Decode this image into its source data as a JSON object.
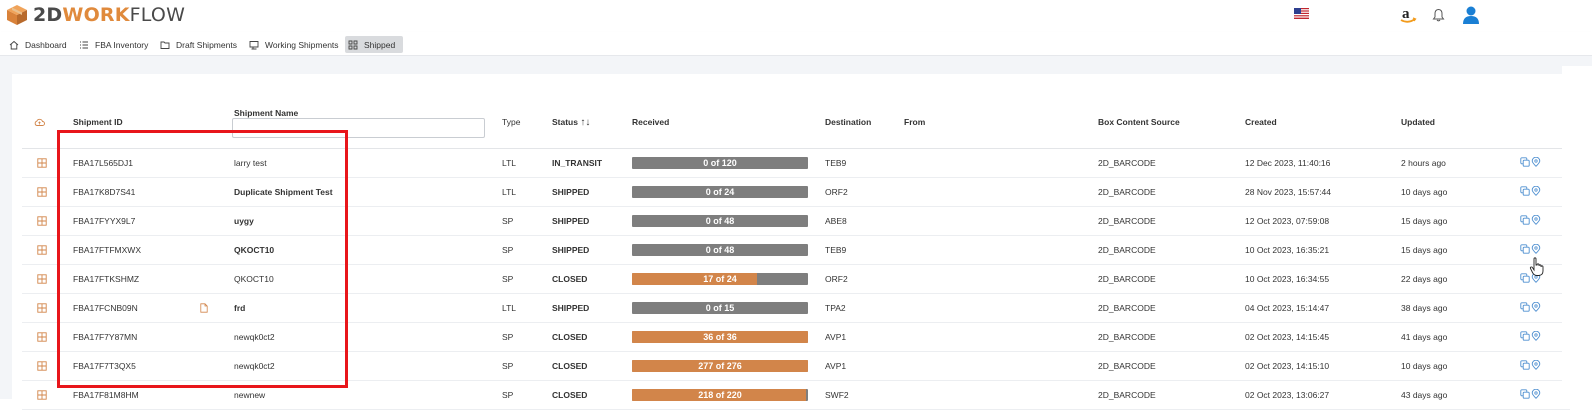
{
  "app": {
    "brand_a": "2D",
    "brand_b": "WORK",
    "brand_c": "FLOW"
  },
  "topbar_icons": [
    "us-flag-icon",
    "amazon-icon",
    "bell-icon",
    "user-icon"
  ],
  "nav": [
    {
      "label": "Dashboard",
      "icon": "home-icon"
    },
    {
      "label": "FBA Inventory",
      "icon": "list-icon"
    },
    {
      "label": "Draft Shipments",
      "icon": "folder-icon"
    },
    {
      "label": "Working Shipments",
      "icon": "monitor-icon"
    },
    {
      "label": "Shipped",
      "icon": "grid-icon",
      "active": true
    }
  ],
  "table": {
    "headers": {
      "shipment_id": "Shipment ID",
      "shipment_name": "Shipment Name",
      "type": "Type",
      "status": "Status",
      "status_sort": "↑↓",
      "received": "Received",
      "destination": "Destination",
      "from": "From",
      "box_content_source": "Box Content Source",
      "created": "Created",
      "updated": "Updated"
    },
    "search_placeholder": "",
    "rows": [
      {
        "id": "FBA17L565DJ1",
        "name": "larry test",
        "name_bold": false,
        "doc": false,
        "type": "LTL",
        "status": "IN_TRANSIT",
        "received_label": "0 of 120",
        "received_fraction": 0,
        "destination": "TEB9",
        "from": "",
        "source": "2D_BARCODE",
        "created": "12 Dec 2023, 11:40:16",
        "updated": "2 hours ago"
      },
      {
        "id": "FBA17K8D7S41",
        "name": "Duplicate Shipment Test",
        "name_bold": true,
        "doc": false,
        "type": "LTL",
        "status": "SHIPPED",
        "received_label": "0 of 24",
        "received_fraction": 0,
        "destination": "ORF2",
        "from": "",
        "source": "2D_BARCODE",
        "created": "28 Nov 2023, 15:57:44",
        "updated": "10 days ago"
      },
      {
        "id": "FBA17FYYX9L7",
        "name": "uygy",
        "name_bold": true,
        "doc": false,
        "type": "SP",
        "status": "SHIPPED",
        "received_label": "0 of 48",
        "received_fraction": 0,
        "destination": "ABE8",
        "from": "",
        "source": "2D_BARCODE",
        "created": "12 Oct 2023, 07:59:08",
        "updated": "15 days ago"
      },
      {
        "id": "FBA17FTFMXWX",
        "name": "QKOCT10",
        "name_bold": true,
        "doc": false,
        "type": "SP",
        "status": "SHIPPED",
        "received_label": "0 of 48",
        "received_fraction": 0,
        "destination": "TEB9",
        "from": "",
        "source": "2D_BARCODE",
        "created": "10 Oct 2023, 16:35:21",
        "updated": "15 days ago"
      },
      {
        "id": "FBA17FTKSHMZ",
        "name": "QKOCT10",
        "name_bold": false,
        "doc": false,
        "type": "SP",
        "status": "CLOSED",
        "received_label": "17 of 24",
        "received_fraction": 0.708,
        "destination": "ORF2",
        "from": "",
        "source": "2D_BARCODE",
        "created": "10 Oct 2023, 16:34:55",
        "updated": "22 days ago"
      },
      {
        "id": "FBA17FCNB09N",
        "name": "frd",
        "name_bold": true,
        "doc": true,
        "type": "LTL",
        "status": "SHIPPED",
        "received_label": "0 of 15",
        "received_fraction": 0,
        "destination": "TPA2",
        "from": "",
        "source": "2D_BARCODE",
        "created": "04 Oct 2023, 15:14:47",
        "updated": "38 days ago"
      },
      {
        "id": "FBA17F7Y87MN",
        "name": "newqk0ct2",
        "name_bold": false,
        "doc": false,
        "type": "SP",
        "status": "CLOSED",
        "received_label": "36 of 36",
        "received_fraction": 1,
        "destination": "AVP1",
        "from": "",
        "source": "2D_BARCODE",
        "created": "02 Oct 2023, 14:15:45",
        "updated": "41 days ago"
      },
      {
        "id": "FBA17F7T3QX5",
        "name": "newqk0ct2",
        "name_bold": false,
        "doc": false,
        "type": "SP",
        "status": "CLOSED",
        "received_label": "277 of 276",
        "received_fraction": 1,
        "destination": "AVP1",
        "from": "",
        "source": "2D_BARCODE",
        "created": "02 Oct 2023, 14:15:10",
        "updated": "10 days ago"
      },
      {
        "id": "FBA17F81M8HM",
        "name": "newnew",
        "name_bold": false,
        "doc": false,
        "type": "SP",
        "status": "CLOSED",
        "received_label": "218 of 220",
        "received_fraction": 0.991,
        "destination": "SWF2",
        "from": "",
        "source": "2D_BARCODE",
        "created": "02 Oct 2023, 13:06:27",
        "updated": "43 days ago"
      }
    ]
  },
  "colors": {
    "accent_orange": "#d2854a",
    "bar_gray": "#7e7e7e",
    "highlight_red": "#e8161b",
    "icon_blue": "#4e8fd0",
    "user_blue": "#1a7fd4"
  }
}
